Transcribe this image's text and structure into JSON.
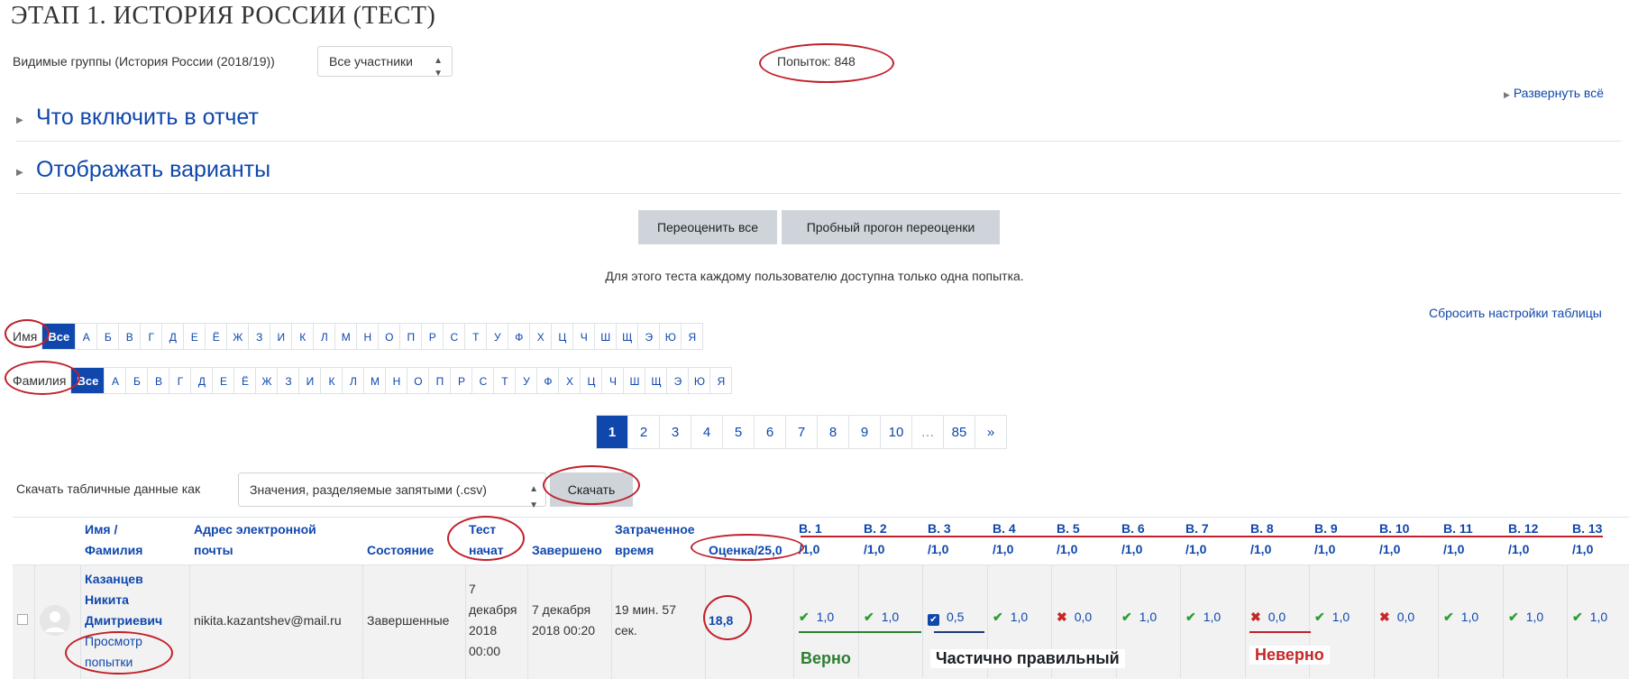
{
  "page": {
    "title": "ЭТАП 1. ИСТОРИЯ РОССИИ (ТЕСТ)",
    "groups_label": "Видимые группы (История России (2018/19))",
    "groups_select": "Все участники",
    "attempts": "Попыток: 848",
    "expand_all": "Развернуть всё",
    "section_include": "Что включить в отчет",
    "section_display": "Отображать варианты",
    "btn_regrade_all": "Переоценить все",
    "btn_regrade_dry": "Пробный прогон переоценки",
    "info": "Для этого теста каждому пользователю доступна только одна попытка.",
    "reset_table": "Сбросить настройки таблицы"
  },
  "filters": {
    "firstname_label": "Имя",
    "lastname_label": "Фамилия",
    "all": "Все",
    "letters": [
      "А",
      "Б",
      "В",
      "Г",
      "Д",
      "Е",
      "Ё",
      "Ж",
      "З",
      "И",
      "К",
      "Л",
      "М",
      "Н",
      "О",
      "П",
      "Р",
      "С",
      "Т",
      "У",
      "Ф",
      "Х",
      "Ц",
      "Ч",
      "Ш",
      "Щ",
      "Э",
      "Ю",
      "Я"
    ]
  },
  "pagination": [
    "1",
    "2",
    "3",
    "4",
    "5",
    "6",
    "7",
    "8",
    "9",
    "10",
    "…",
    "85",
    "»"
  ],
  "download": {
    "label": "Скачать табличные данные как",
    "format": "Значения, разделяемые запятыми (.csv)",
    "button": "Скачать"
  },
  "table": {
    "headers": {
      "name_1": "Имя /",
      "name_2": "Фамилия",
      "email_1": "Адрес электронной",
      "email_2": "почты",
      "state": "Состояние",
      "started_1": "Тест",
      "started_2": "начат",
      "finished": "Завершено",
      "time_1": "Затраченное",
      "time_2": "время",
      "grade": "Оценка/25,0"
    },
    "questions": [
      {
        "h1": "В. 1",
        "h2": "/1,0",
        "mark": "1,0",
        "state": "correct"
      },
      {
        "h1": "В. 2",
        "h2": "/1,0",
        "mark": "1,0",
        "state": "correct"
      },
      {
        "h1": "В. 3",
        "h2": "/1,0",
        "mark": "0,5",
        "state": "partial"
      },
      {
        "h1": "В. 4",
        "h2": "/1,0",
        "mark": "1,0",
        "state": "correct"
      },
      {
        "h1": "В. 5",
        "h2": "/1,0",
        "mark": "0,0",
        "state": "wrong"
      },
      {
        "h1": "В. 6",
        "h2": "/1,0",
        "mark": "1,0",
        "state": "correct"
      },
      {
        "h1": "В. 7",
        "h2": "/1,0",
        "mark": "1,0",
        "state": "correct"
      },
      {
        "h1": "В. 8",
        "h2": "/1,0",
        "mark": "0,0",
        "state": "wrong"
      },
      {
        "h1": "В. 9",
        "h2": "/1,0",
        "mark": "1,0",
        "state": "correct"
      },
      {
        "h1": "В. 10",
        "h2": "/1,0",
        "mark": "0,0",
        "state": "wrong"
      },
      {
        "h1": "В. 11",
        "h2": "/1,0",
        "mark": "1,0",
        "state": "correct"
      },
      {
        "h1": "В. 12",
        "h2": "/1,0",
        "mark": "1,0",
        "state": "correct"
      },
      {
        "h1": "В. 13",
        "h2": "/1,0",
        "mark": "1,0",
        "state": "correct"
      }
    ],
    "row": {
      "name_1": "Казанцев",
      "name_2": "Никита",
      "name_3": "Дмитриевич",
      "review_1": "Просмотр",
      "review_2": "попытки",
      "email": "nikita.kazantshev@mail.ru",
      "state": "Завершенные",
      "started_1": "7",
      "started_2": "декабря",
      "started_3": "2018",
      "started_4": "00:00",
      "finished_1": "7 декабря",
      "finished_2": "2018 00:20",
      "time_1": "19 мин. 57",
      "time_2": "сек.",
      "grade": "18,8"
    }
  },
  "annotations": {
    "correct": "Верно",
    "partial": "Частично правильный",
    "wrong": "Неверно",
    "colors": {
      "correct": "#2e7d32",
      "partial": "#1d2125",
      "wrong": "#c62828",
      "ellipse": "#c0202b"
    }
  }
}
